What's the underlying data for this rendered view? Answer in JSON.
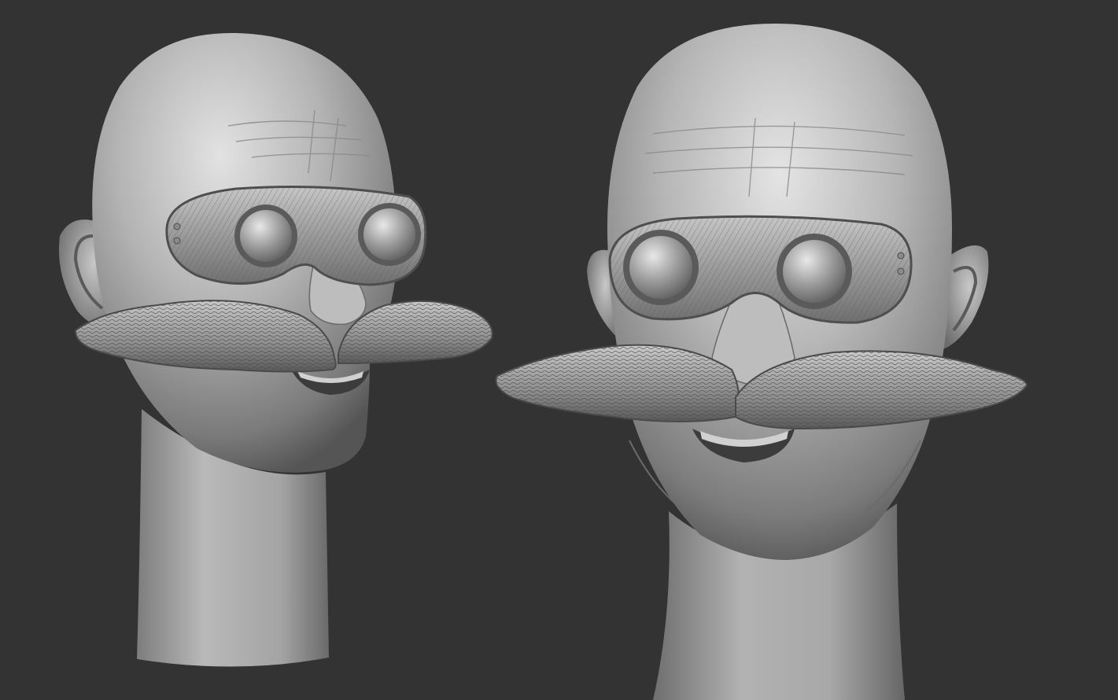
{
  "scene": {
    "background_color": "#333333",
    "material_color": "#a8a8a8",
    "highlight_color": "#e6e6e6",
    "shadow_color": "#4a4a4a",
    "views": [
      {
        "name": "three-quarter-view"
      },
      {
        "name": "front-view"
      }
    ]
  }
}
